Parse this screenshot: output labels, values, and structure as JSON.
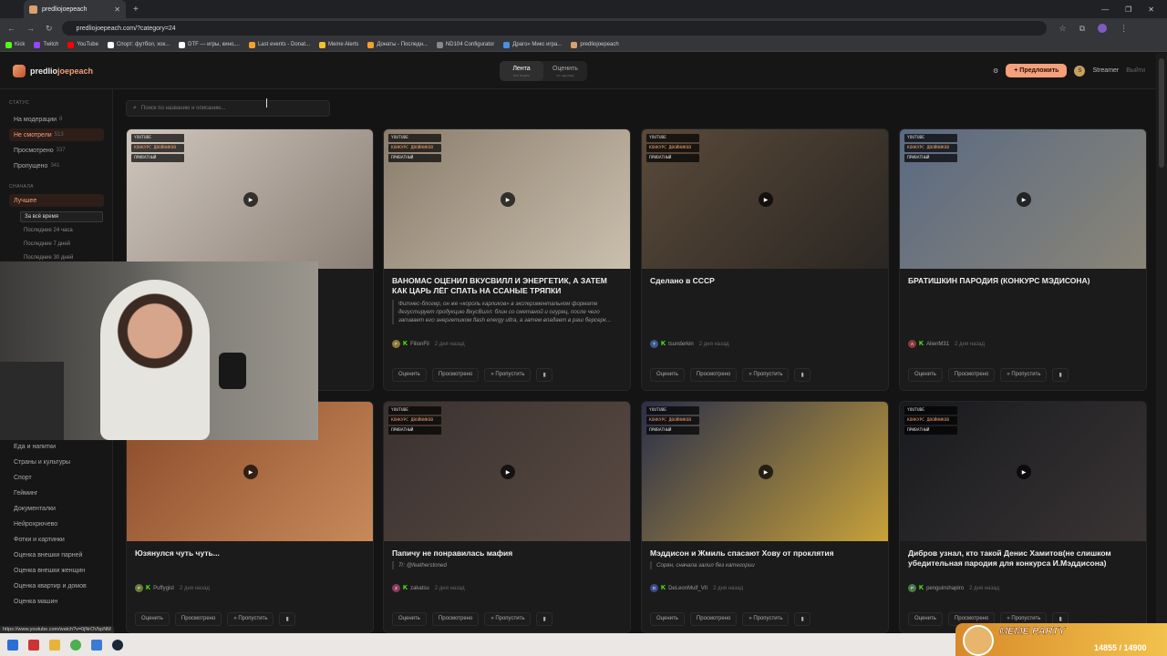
{
  "browser": {
    "tab_title": "predliojoepeach",
    "url": "predliojoepeach.com/?category=24",
    "bookmarks": [
      {
        "label": "Kick",
        "color": "#53fc18"
      },
      {
        "label": "Twitch",
        "color": "#9146ff"
      },
      {
        "label": "YouTube",
        "color": "#ff0000"
      },
      {
        "label": "Спорт: футбол, хок...",
        "color": "#ffffff"
      },
      {
        "label": "DTF — игры, кино,...",
        "color": "#ffffff"
      },
      {
        "label": "Last events - Donat...",
        "color": "#f4a030"
      },
      {
        "label": "Meme Alerts",
        "color": "#f4c030"
      },
      {
        "label": "Донаты - Последн...",
        "color": "#f4a030"
      },
      {
        "label": "ND104 Configurator",
        "color": "#888888"
      },
      {
        "label": "Драго» Микс игра...",
        "color": "#4a90e2"
      },
      {
        "label": "predliojoepeach",
        "color": "#d9a070"
      }
    ]
  },
  "header": {
    "logo_main": "predlio",
    "logo_accent": "joepeach",
    "switch": [
      {
        "label": "Лента",
        "sub": "все видео"
      },
      {
        "label": "Оценить",
        "sub": "по одному"
      }
    ],
    "propose_label": "+ Предложить",
    "user_initial": "S",
    "user_name": "Streamer",
    "logout": "Выйти"
  },
  "sidebar": {
    "status_heading": "СТАТУС",
    "status_items": [
      {
        "label": "На модерации",
        "count": "8"
      },
      {
        "label": "Не смотрели",
        "count": "513"
      },
      {
        "label": "Просмотрено",
        "count": "337"
      },
      {
        "label": "Пропущено",
        "count": "341"
      }
    ],
    "sort_heading": "СНАЧАЛА",
    "sort_best": "Лучшее",
    "sort_periods": [
      "За всё время",
      "Последние 24 часа",
      "Последние 7 дней",
      "Последние 30 дней"
    ],
    "categories": [
      "Еда и напитки",
      "Страны и культуры",
      "Спорт",
      "Гейминг",
      "Документалки",
      "Нейрохрючево",
      "Фотки и картинки",
      "Оценка внешки парней",
      "Оценка внешки женщин",
      "Оценка квартир и домов",
      "Оценка машин"
    ]
  },
  "search": {
    "placeholder": "Поиск по названию и описанию..."
  },
  "action_labels": {
    "rate": "Оценить",
    "watched": "Просмотрено",
    "skip": "» Пропустить",
    "pin": "▮"
  },
  "cards": [
    {
      "badges": [
        "YOUTUBE",
        "КОНКУРС ДВОЙНИКОВ",
        "ПРИВАТНЫЙ"
      ],
      "title": "",
      "desc": "",
      "author": "",
      "initial": "",
      "av_color": "#666666",
      "time": ""
    },
    {
      "badges": [
        "YOUTUBE",
        "КОНКУРС ДВОЙНИКОВ",
        "ПРИВАТНЫЙ"
      ],
      "title": "ВАНОМАС ОЦЕНИЛ ВКУСВИЛЛ И ЭНЕРГЕТИК, А ЗАТЕМ КАК ЦАРЬ ЛЁГ СПАТЬ НА ССАНЫЕ ТРЯПКИ",
      "desc": "Фитнес-блогер, он же «король карликов» в экспериментальном формате дегустирует продукцию ВкусВилл: блин со сметаной и огурец, после чего запивает его энергетиком flash energy ultra, а затем впадает в раш берсерк...",
      "author": "FilionFil",
      "initial": "F",
      "av_color": "#8a7a3a",
      "time": "2 дня назад"
    },
    {
      "badges": [
        "YOUTUBE",
        "КОНКУРС ДВОЙНИКОВ",
        "ПРИВАТНЫЙ"
      ],
      "title": "Сделано в СССР",
      "desc": "",
      "author": "tsunderkin",
      "initial": "T",
      "av_color": "#3a5a8a",
      "time": "2 дня назад"
    },
    {
      "badges": [
        "YOUTUBE",
        "КОНКУРС ДВОЙНИКОВ",
        "ПРИВАТНЫЙ"
      ],
      "title": "БРАТИШКИН ПАРОДИЯ (КОНКУРС МЭДИСОНА)",
      "desc": "",
      "author": "AlienM31",
      "initial": "A",
      "av_color": "#8a3a3a",
      "time": "2 дня назад"
    },
    {
      "badges": [],
      "title": "Юзянулся чуть чуть...",
      "desc": "",
      "author": "Puffygist",
      "initial": "P",
      "av_color": "#6a7a3a",
      "time": "2 дня назад"
    },
    {
      "badges": [
        "YOUTUBE",
        "КОНКУРС ДВОЙНИКОВ",
        "ПРИВАТНЫЙ"
      ],
      "title": "Папичу не понравилась мафия",
      "desc": "Tr: @featherstoned",
      "author": "zakatsu",
      "initial": "Z",
      "av_color": "#8a3a5a",
      "time": "2 дня назад"
    },
    {
      "badges": [
        "YOUTUBE",
        "КОНКУРС ДВОЙНИКОВ",
        "ПРИВАТНЫЙ"
      ],
      "title": "Мэддисон и Жмиль спасают Хову от проклятия",
      "desc": "Сорян, сначала залил без категории",
      "author": "DeLeonMulf_VII",
      "initial": "D",
      "av_color": "#3a4a8a",
      "time": "2 дня назад"
    },
    {
      "badges": [
        "YOUTUBE",
        "КОНКУРС ДВОЙНИКОВ",
        "ПРИВАТНЫЙ"
      ],
      "title": "Дибров узнал, кто такой Денис Хамитов(не слишком убедительная пародия для конкурса И.Мэддисона)",
      "desc": "",
      "author": "penguinshapiro",
      "initial": "P",
      "av_color": "#4a7a4a",
      "time": "2 дня назад"
    }
  ],
  "overlay": {
    "status_url": "https://www.youtube.com/watch?v=0jNrOVbpNM",
    "meme_title": "MEME PARTY",
    "meme_count": "14855 / 14900"
  }
}
